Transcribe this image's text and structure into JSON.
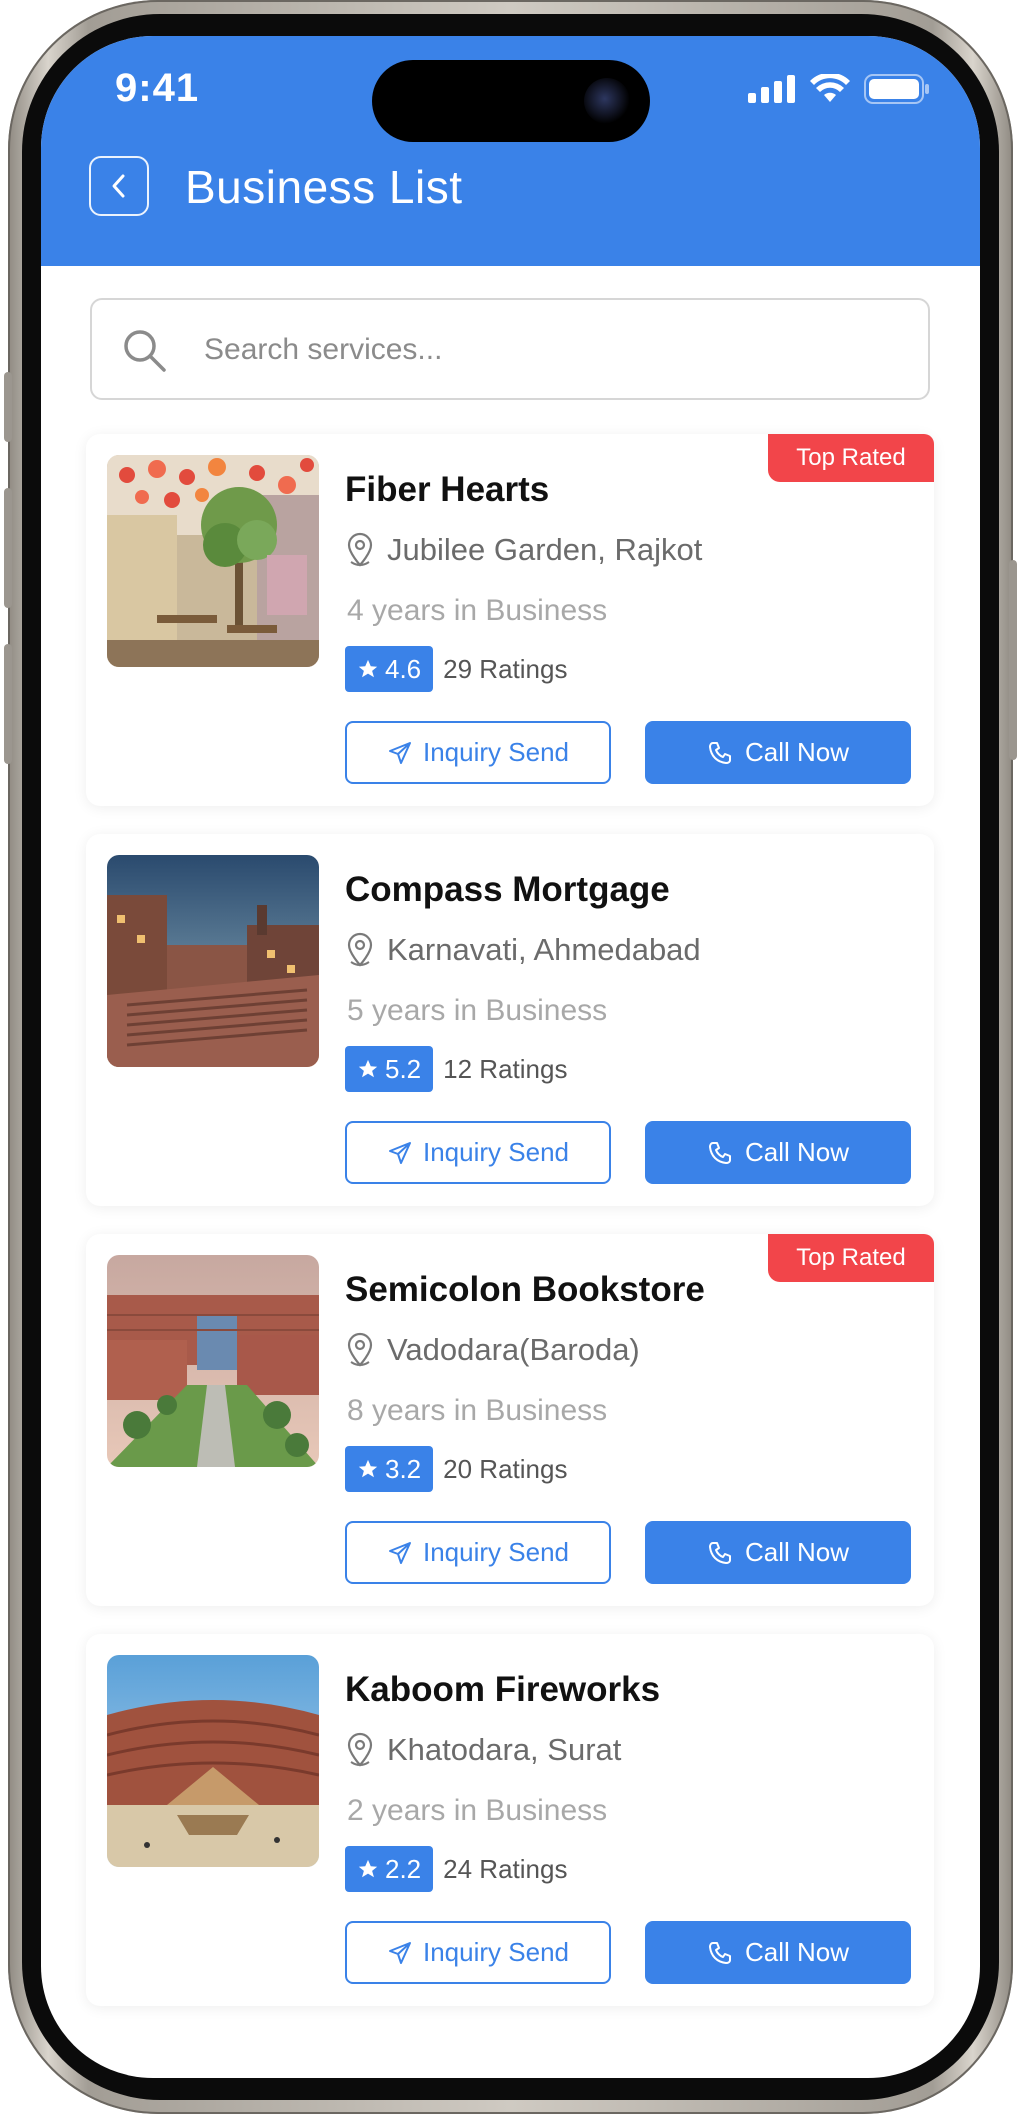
{
  "status_bar": {
    "time": "9:41"
  },
  "header": {
    "title": "Business List"
  },
  "search": {
    "placeholder": "Search services..."
  },
  "colors": {
    "primary": "#3a82e8",
    "badge": "#f2454a",
    "muted": "#a8a8a8"
  },
  "businesses": [
    {
      "name": "Fiber Hearts",
      "location": "Jubilee Garden, Rajkot",
      "years": "4 years in Business",
      "rating": "4.6",
      "ratings_count": "29 Ratings",
      "badge": "Top Rated",
      "inquiry_label": "Inquiry Send",
      "call_label": "Call Now"
    },
    {
      "name": "Compass Mortgage",
      "location": "Karnavati, Ahmedabad",
      "years": "5 years in Business",
      "rating": "5.2",
      "ratings_count": "12 Ratings",
      "badge": "",
      "inquiry_label": "Inquiry Send",
      "call_label": "Call Now"
    },
    {
      "name": "Semicolon Bookstore",
      "location": "Vadodara(Baroda)",
      "years": "8 years in Business",
      "rating": "3.2",
      "ratings_count": "20 Ratings",
      "badge": "Top Rated",
      "inquiry_label": "Inquiry Send",
      "call_label": "Call Now"
    },
    {
      "name": "Kaboom Fireworks",
      "location": "Khatodara, Surat",
      "years": "2 years in Business",
      "rating": "2.2",
      "ratings_count": "24 Ratings",
      "badge": "",
      "inquiry_label": "Inquiry Send",
      "call_label": "Call Now"
    }
  ]
}
